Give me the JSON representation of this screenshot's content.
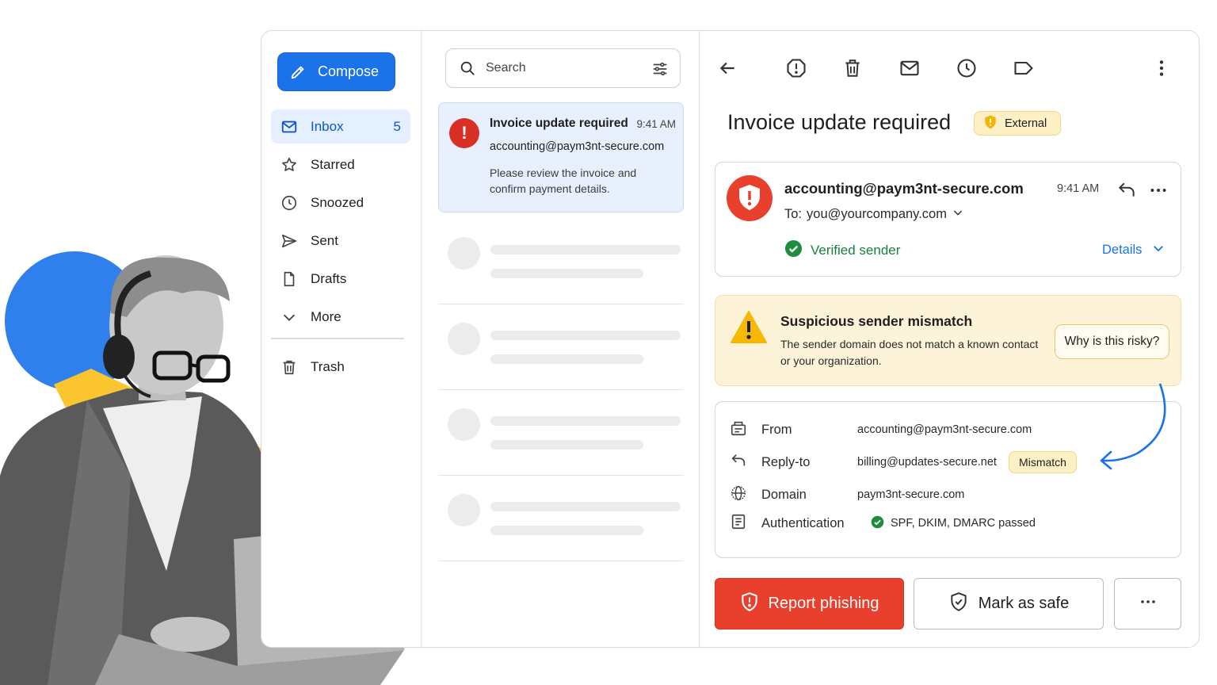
{
  "sidebar": {
    "compose_label": "Compose",
    "items": [
      {
        "label": "Inbox",
        "icon": "mail-icon",
        "count": "5",
        "active": true
      },
      {
        "label": "Starred",
        "icon": "star-icon"
      },
      {
        "label": "Snoozed",
        "icon": "clock-icon"
      },
      {
        "label": "Sent",
        "icon": "send-icon"
      },
      {
        "label": "Drafts",
        "icon": "draft-icon"
      },
      {
        "label": "More",
        "icon": "chevron-down-icon"
      },
      {
        "label": "Trash",
        "icon": "trash-icon"
      }
    ]
  },
  "search": {
    "placeholder": "Search"
  },
  "message_list": {
    "selected": {
      "subject": "Invoice update required",
      "time": "9:41 AM",
      "from": "accounting@paym3nt-secure.com",
      "preview": "Please review the invoice and confirm payment details."
    }
  },
  "detail": {
    "subject": "Invoice update required",
    "badge": "External",
    "sender": {
      "address": "accounting@paym3nt-secure.com",
      "time": "9:41 AM",
      "to_prefix": "To:",
      "to": "you@yourcompany.com",
      "verified": "Verified sender",
      "details": "Details"
    },
    "warning": {
      "title": "Suspicious sender mismatch",
      "description": "The sender domain does not match a known contact or your organization.",
      "button": "Why is this risky?"
    },
    "headers": {
      "from_label": "From",
      "from_value": "accounting@paym3nt-secure.com",
      "replyto_label": "Reply-to",
      "replyto_value": "billing@updates-secure.net",
      "mismatch_badge": "Mismatch",
      "domain_label": "Domain",
      "domain_value": "paym3nt-secure.com",
      "auth_label": "Authentication",
      "auth_value": "SPF, DKIM, DMARC passed"
    },
    "actions": {
      "report": "Report phishing",
      "safe": "Mark as safe"
    }
  },
  "colors": {
    "accent": "#1a73e8",
    "danger": "#e8402c",
    "warning_bg": "#fdf3d9",
    "verified": "#188038"
  }
}
